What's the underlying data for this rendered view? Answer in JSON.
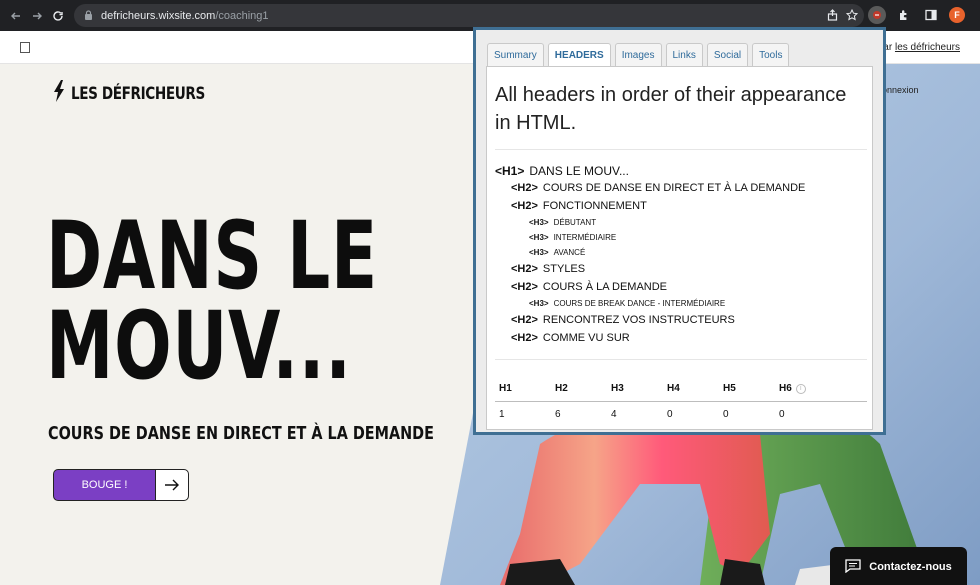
{
  "browser": {
    "url_host": "defricheurs.wixsite.com",
    "url_path": "/coaching1",
    "avatar_letter": "F"
  },
  "wix_bar": {
    "prefix": "ar",
    "link": "les défricheurs"
  },
  "site": {
    "brand": "LES DÉFRICHEURS",
    "login": "onnexion",
    "hero_line1": "DANS LE",
    "hero_line2": "MOUV...",
    "subtitle": "COURS DE DANSE EN DIRECT ET À LA DEMANDE",
    "cta_label": "BOUGE !",
    "chat_label": "Contactez-nous",
    "accent_color": "#7b3fc4"
  },
  "popup": {
    "tabs": [
      {
        "label": "Summary",
        "active": false
      },
      {
        "label": "HEADERS",
        "active": true
      },
      {
        "label": "Images",
        "active": false
      },
      {
        "label": "Links",
        "active": false
      },
      {
        "label": "Social",
        "active": false
      },
      {
        "label": "Tools",
        "active": false
      }
    ],
    "title": "All headers in order of their appearance in HTML.",
    "headers": [
      {
        "tag": "<H1>",
        "text": "DANS LE MOUV...",
        "level": 1
      },
      {
        "tag": "<H2>",
        "text": "COURS DE DANSE EN DIRECT ET À LA DEMANDE",
        "level": 2
      },
      {
        "tag": "<H2>",
        "text": "FONCTIONNEMENT",
        "level": 2
      },
      {
        "tag": "<H3>",
        "text": "DÉBUTANT",
        "level": 3
      },
      {
        "tag": "<H3>",
        "text": "INTERMÉDIAIRE",
        "level": 3
      },
      {
        "tag": "<H3>",
        "text": "AVANCÉ",
        "level": 3
      },
      {
        "tag": "<H2>",
        "text": "STYLES",
        "level": 2
      },
      {
        "tag": "<H2>",
        "text": "COURS À LA DEMANDE",
        "level": 2
      },
      {
        "tag": "<H3>",
        "text": "COURS DE BREAK DANCE - INTERMÉDIAIRE",
        "level": 3
      },
      {
        "tag": "<H2>",
        "text": "RENCONTREZ VOS INSTRUCTEURS",
        "level": 2
      },
      {
        "tag": "<H2>",
        "text": "COMME VU SUR",
        "level": 2
      }
    ],
    "counts": {
      "labels": [
        "H1",
        "H2",
        "H3",
        "H4",
        "H5",
        "H6"
      ],
      "values": [
        "1",
        "6",
        "4",
        "0",
        "0",
        "0"
      ],
      "info_glyph": "i"
    }
  }
}
